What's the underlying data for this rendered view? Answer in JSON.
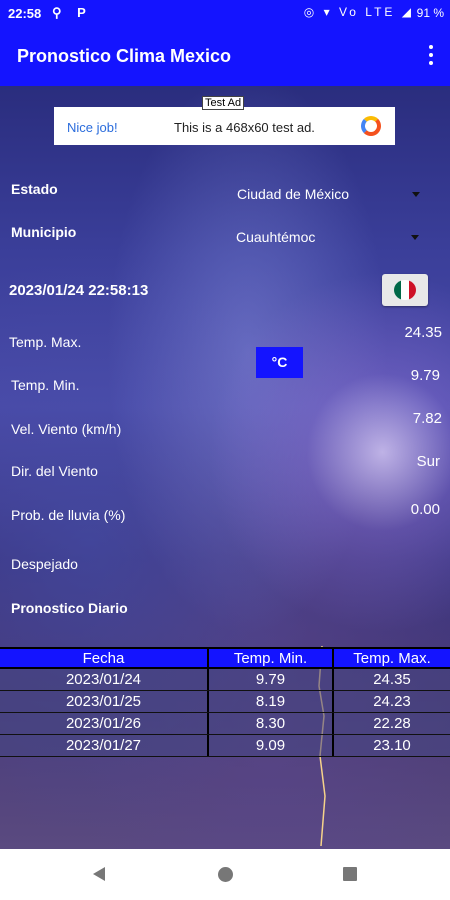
{
  "status_bar": {
    "time": "22:58",
    "left_icons": "⚲ P",
    "right_icons": "◎ ▾ Vo LTE ◢",
    "battery": "91 %"
  },
  "app_bar": {
    "title": "Pronostico Clima Mexico"
  },
  "ad": {
    "tag": "Test Ad",
    "left_text": "Nice job!",
    "text": "This is a 468x60 test ad."
  },
  "form": {
    "estado_label": "Estado",
    "estado_value": "Ciudad de México",
    "municipio_label": "Municipio",
    "municipio_value": "Cuauhtémoc"
  },
  "datetime": "2023/01/24 22:58:13",
  "unit_button": "°C",
  "weather": {
    "temp_max_label": "Temp. Max.",
    "temp_max_value": "24.35",
    "temp_min_label": "Temp. Min.",
    "temp_min_value": "9.79",
    "wind_speed_label": "Vel. Viento (km/h)",
    "wind_speed_value": "7.82",
    "wind_dir_label": "Dir. del Viento",
    "wind_dir_value": "Sur",
    "rain_label": "Prob. de lluvia (%)",
    "rain_value": "0.00",
    "condition": "Despejado",
    "forecast_title": "Pronostico Diario"
  },
  "forecast_table": {
    "headers": [
      "Fecha",
      "Temp. Min.",
      "Temp. Max."
    ],
    "rows": [
      [
        "2023/01/24",
        "9.79",
        "24.35"
      ],
      [
        "2023/01/25",
        "8.19",
        "24.23"
      ],
      [
        "2023/01/26",
        "8.30",
        "22.28"
      ],
      [
        "2023/01/27",
        "9.09",
        "23.10"
      ]
    ]
  },
  "colors": {
    "accent": "#1414ff",
    "flag_green": "#006847",
    "flag_white": "#ffffff",
    "flag_red": "#ce1126"
  }
}
